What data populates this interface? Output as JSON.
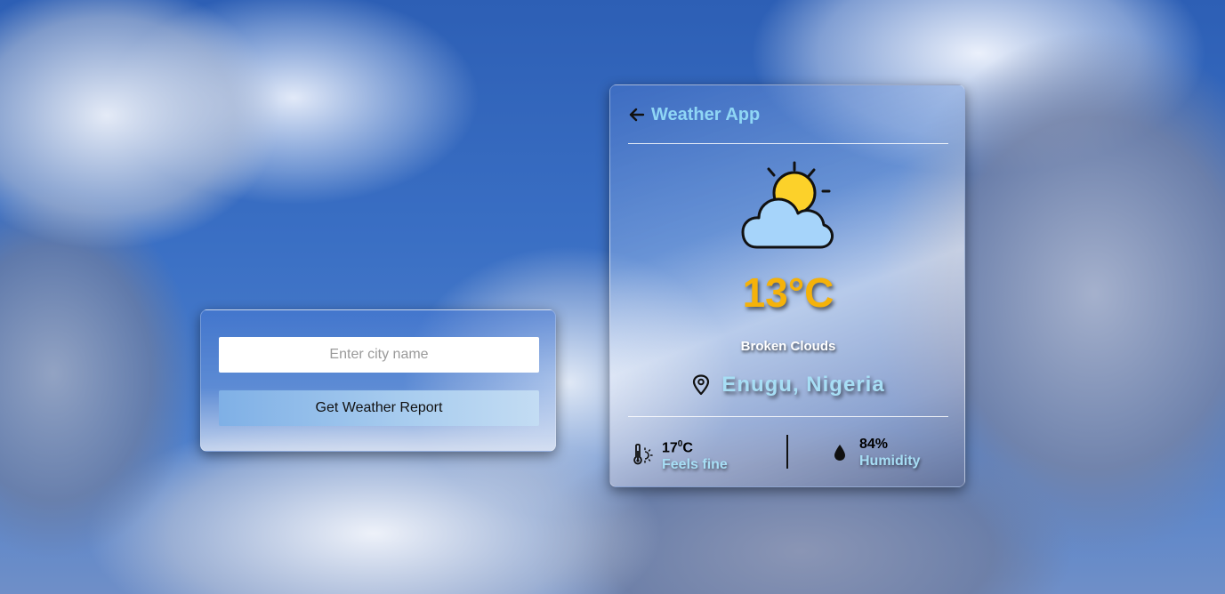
{
  "search": {
    "placeholder": "Enter city name",
    "button_label": "Get Weather Report"
  },
  "card": {
    "title": "Weather App",
    "back_icon": "arrow-left-icon",
    "weather_icon": "partly-cloudy-icon",
    "temperature": "13",
    "temperature_unit": "°C",
    "description": "Broken Clouds",
    "location_icon": "map-pin-icon",
    "location": "Enugu, Nigeria",
    "feels_like": {
      "icon": "thermometer-sun-icon",
      "value": "17",
      "unit": "C",
      "label": "Feels fine"
    },
    "humidity": {
      "icon": "droplet-icon",
      "value": "84%",
      "label": "Humidity"
    }
  },
  "colors": {
    "title": "#8fd6f5",
    "temperature": "#f5b20a",
    "label": "#a7def5",
    "sun": "#fcd12a",
    "cloud": "#a6d4fa"
  }
}
